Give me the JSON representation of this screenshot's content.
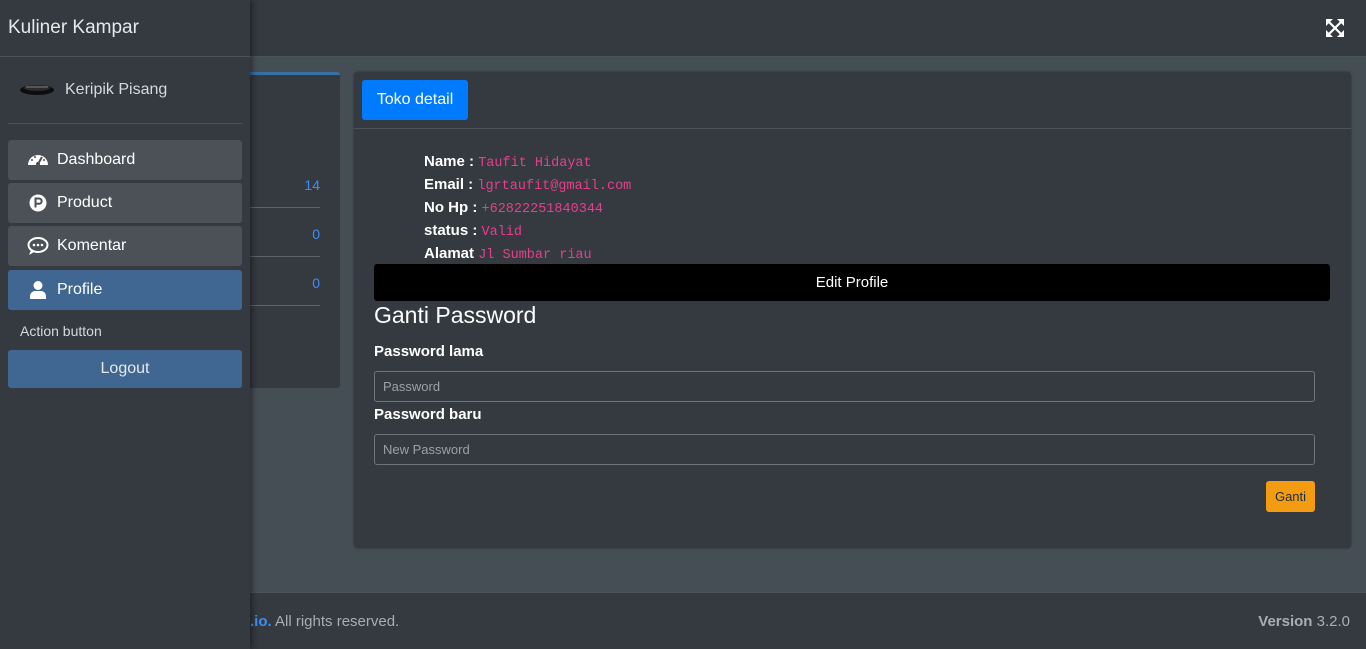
{
  "brand": "Kuliner Kampar",
  "user": {
    "name": "Keripik Pisang"
  },
  "nav": {
    "items": [
      {
        "label": "Dashboard",
        "icon": "dashboard-icon"
      },
      {
        "label": "Product",
        "icon": "product-icon"
      },
      {
        "label": "Komentar",
        "icon": "comment-icon"
      },
      {
        "label": "Profile",
        "icon": "user-icon"
      }
    ],
    "header": "Action button",
    "logout": "Logout"
  },
  "stats": [
    "14",
    "0",
    "0"
  ],
  "card": {
    "header_button": "Toko detail",
    "info": [
      {
        "label": "Name :",
        "value": "Taufit Hidayat"
      },
      {
        "label": "Email :",
        "value": "lgrtaufit@gmail.com"
      },
      {
        "label": "No Hp :",
        "value": "+62822251840344"
      },
      {
        "label": "status :",
        "value": "Valid"
      },
      {
        "label": "Alamat",
        "value": "Jl Sumbar riau"
      }
    ],
    "edit_button": "Edit Profile",
    "ganti_title": "Ganti Password",
    "old_label": "Password lama",
    "old_placeholder": "Password",
    "new_label": "Password baru",
    "new_placeholder": "New Password",
    "submit": "Ganti"
  },
  "footer": {
    "link": ".io.",
    "rights": " All rights reserved.",
    "version_label": "Version",
    "version": " 3.2.0"
  },
  "colors": {
    "accent_blue": "#007bff",
    "active_nav": "#3f6791",
    "code_pink": "#e83e8c",
    "warning": "#f39c12"
  }
}
